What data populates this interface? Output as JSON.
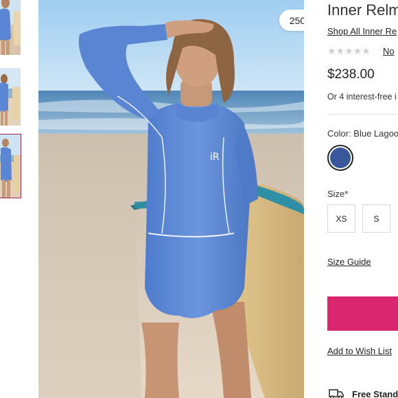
{
  "product": {
    "title": "Inner Relm",
    "shop_all_link": "Shop All Inner Re",
    "stars": "★★★★★",
    "reviews_link": "No",
    "price": "$238.00",
    "installments": "Or 4 interest-free i",
    "color_label": "Color: Blue Lagoo",
    "size_label": "Size*",
    "sizes": [
      "XS",
      "S"
    ],
    "size_guide_link": "Size Guide",
    "wishlist_link": "Add to Wish List",
    "shipping_text": "Free Stand"
  },
  "gallery": {
    "wishlist_count": "250",
    "selected_thumbnail": 3
  },
  "colors": {
    "accent": "#d9266f",
    "swatch": "#38589b",
    "thumb_outline": "#a0225e",
    "wetsuit": "#5b86d6"
  },
  "icons": [
    "heart-icon",
    "expand-icon",
    "truck-icon",
    "star-icon"
  ]
}
